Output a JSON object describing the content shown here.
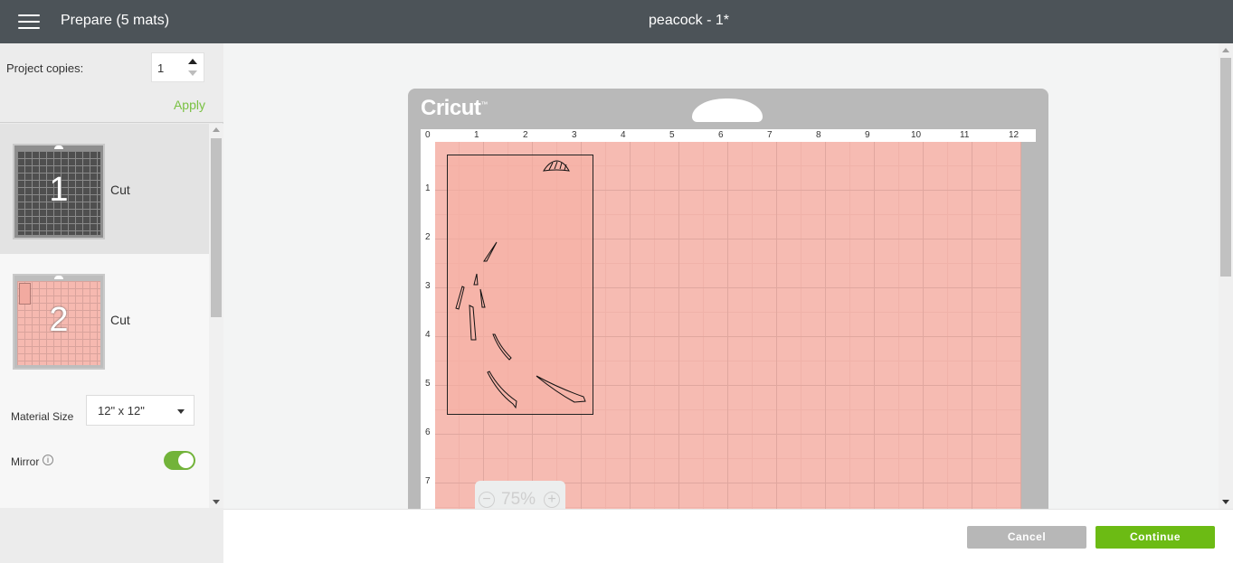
{
  "header": {
    "menu_icon": "hamburger-menu-icon",
    "prepare_title": "Prepare (5 mats)",
    "project_name": "peacock - 1*"
  },
  "sidebar": {
    "copies_label": "Project copies:",
    "copies_value": "1",
    "apply_label": "Apply",
    "mats": [
      {
        "number": "1",
        "label": "Cut"
      },
      {
        "number": "2",
        "label": "Cut"
      }
    ],
    "material_size_label": "Material Size",
    "material_size_value": "12\" x 12\"",
    "mirror_label": "Mirror",
    "mirror_on": true
  },
  "canvas": {
    "logo": "Cricut",
    "ruler_top": [
      "0",
      "1",
      "2",
      "3",
      "4",
      "5",
      "6",
      "7",
      "8",
      "9",
      "10",
      "11",
      "12"
    ],
    "ruler_left": [
      "1",
      "2",
      "3",
      "4",
      "5",
      "6",
      "7"
    ],
    "zoom_value": "75%",
    "zoom_out_symbol": "−",
    "zoom_in_symbol": "+"
  },
  "footer": {
    "cancel_label": "Cancel",
    "continue_label": "Continue"
  },
  "colors": {
    "topbar": "#4c5358",
    "accent_green": "#6cbb14",
    "mat_pink": "#f6bbb2"
  }
}
